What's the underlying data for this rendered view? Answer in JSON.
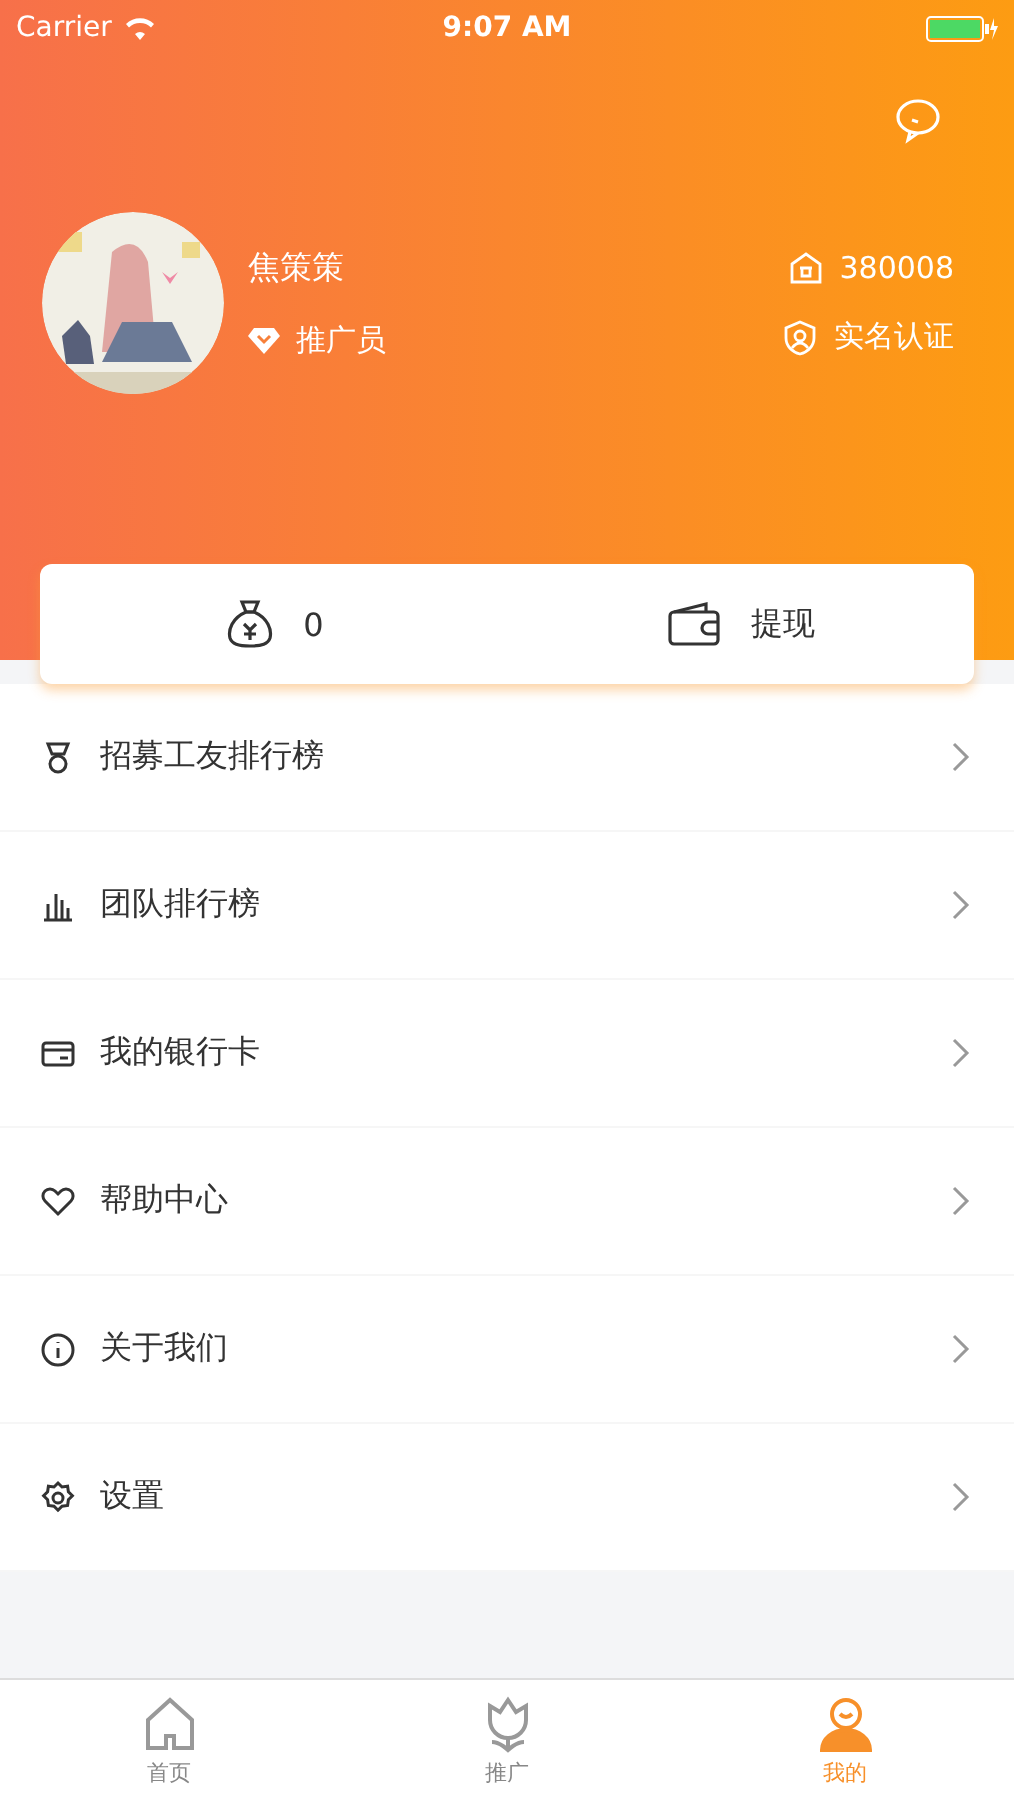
{
  "status_bar": {
    "carrier": "Carrier",
    "time": "9:07 AM"
  },
  "profile": {
    "name": "焦策策",
    "role": "推广员",
    "id": "380008",
    "verify": "实名认证"
  },
  "wallet": {
    "balance": "0",
    "withdraw": "提现"
  },
  "menu": [
    {
      "label": "招募工友排行榜",
      "kind": "medal"
    },
    {
      "label": "团队排行榜",
      "kind": "chart"
    },
    {
      "label": "我的银行卡",
      "kind": "card"
    },
    {
      "label": "帮助中心",
      "kind": "heart"
    },
    {
      "label": "关于我们",
      "kind": "info"
    },
    {
      "label": "设置",
      "kind": "gear"
    }
  ],
  "tab_bar": [
    {
      "label": "首页",
      "kind": "home",
      "selected": false
    },
    {
      "label": "推广",
      "kind": "flower",
      "selected": false
    },
    {
      "label": "我的",
      "kind": "person",
      "selected": true
    }
  ]
}
